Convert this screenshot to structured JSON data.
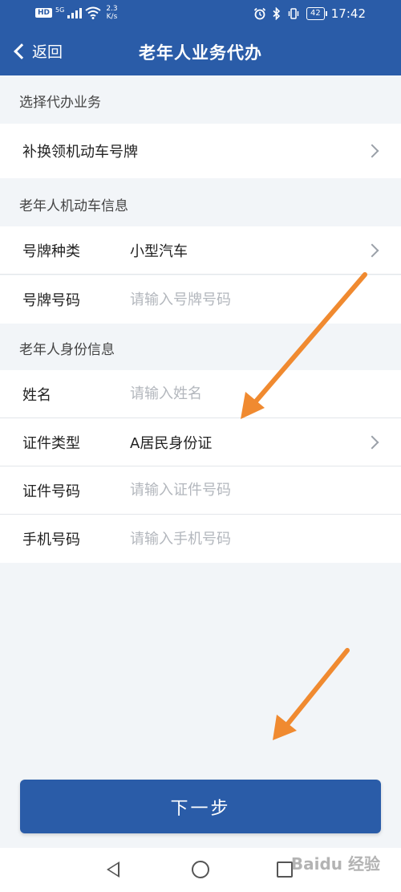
{
  "status_bar": {
    "hd": "HD",
    "network": "5G",
    "speed_value": "2.3",
    "speed_unit": "K/s",
    "battery": "42",
    "time": "17:42"
  },
  "header": {
    "back_label": "返回",
    "title": "老年人业务代办"
  },
  "sections": {
    "service": {
      "label": "选择代办业务",
      "selected": "补换领机动车号牌"
    },
    "vehicle": {
      "label": "老年人机动车信息",
      "plate_type_label": "号牌种类",
      "plate_type_value": "小型汽车",
      "plate_number_label": "号牌号码",
      "plate_number_placeholder": "请输入号牌号码"
    },
    "identity": {
      "label": "老年人身份信息",
      "name_label": "姓名",
      "name_placeholder": "请输入姓名",
      "id_type_label": "证件类型",
      "id_type_value": "A居民身份证",
      "id_number_label": "证件号码",
      "id_number_placeholder": "请输入证件号码",
      "phone_label": "手机号码",
      "phone_placeholder": "请输入手机号码"
    }
  },
  "next_button": "下一步",
  "watermark": "Baidu 经验",
  "colors": {
    "brand": "#2a5ca8",
    "annotation_arrow": "#f08a30"
  }
}
